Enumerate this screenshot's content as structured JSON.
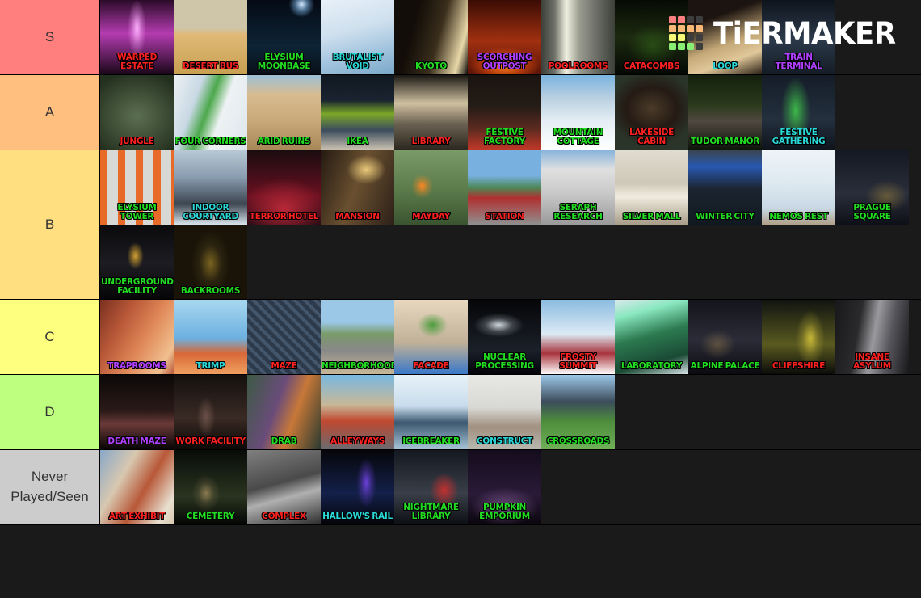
{
  "logo": {
    "text": "TiERMAKER",
    "grid_colors": [
      "#f98080",
      "#f98080",
      "#3d3d3d",
      "#3d3d3d",
      "#f8b878",
      "#f8b878",
      "#f8b878",
      "#f8b878",
      "#f8f878",
      "#f8f878",
      "#3d3d3d",
      "#3d3d3d",
      "#88ef74",
      "#88ef74",
      "#88ef74",
      "#3d3d3d"
    ]
  },
  "background": "#1a1a1a",
  "tiers": [
    {
      "label": "S",
      "color": "#ff7f7f",
      "items": [
        {
          "name": "WARPED ESTATE",
          "text_color": "#ff2020",
          "g1": "#2a0a28",
          "g2": "#b43cb0",
          "g3": "#1a0618",
          "accent": "#ffb0ff",
          "style": "neon-pillar"
        },
        {
          "name": "DESERT BUS",
          "text_color": "#ff2020",
          "g1": "#cfc5a8",
          "g2": "#e0b978",
          "g3": "#c8a050",
          "accent": "#f0e4c0",
          "style": "desert"
        },
        {
          "name": "ELYSIUM MOONBASE",
          "text_color": "#22dd22",
          "g1": "#050a14",
          "g2": "#0d2436",
          "g3": "#081018",
          "accent": "#cfe8ff",
          "style": "moon"
        },
        {
          "name": "BRUTALIST VOID",
          "text_color": "#2ad8d8",
          "g1": "#cfe0ee",
          "g2": "#9fc2dd",
          "g3": "#e8f0f8",
          "accent": "#ffffff",
          "style": "sky"
        },
        {
          "name": "KYOTO",
          "text_color": "#22dd22",
          "g1": "#120d08",
          "g2": "#3a2e1c",
          "g3": "#0a0806",
          "accent": "#e8d8a8",
          "style": "interior-dark"
        },
        {
          "name": "SCORCHING OUTPOST",
          "text_color": "#b040ff",
          "g1": "#3a0c05",
          "g2": "#a03010",
          "g3": "#5a1408",
          "accent": "#ff8820",
          "style": "lava"
        },
        {
          "name": "POOLROOMS",
          "text_color": "#ff2020",
          "g1": "#6e7068",
          "g2": "#9a9c90",
          "g3": "#3c4038",
          "accent": "#f0f0e0",
          "style": "corridor"
        },
        {
          "name": "CATACOMBS",
          "text_color": "#ff2020",
          "g1": "#060a04",
          "g2": "#1c2a10",
          "g3": "#040804",
          "accent": "#68e030",
          "style": "cave"
        },
        {
          "name": "LOOP",
          "text_color": "#2ad8d8",
          "g1": "#1c1410",
          "g2": "#c4a878",
          "g3": "#2a1e14",
          "accent": "#e0c89a",
          "style": "corridor-warm"
        },
        {
          "name": "TRAIN TERMINAL",
          "text_color": "#b040ff",
          "g1": "#0e141c",
          "g2": "#2c3a4a",
          "g3": "#141c26",
          "accent": "#8aa0b8",
          "style": "night-rail"
        }
      ]
    },
    {
      "label": "A",
      "color": "#ffbf7f",
      "items": [
        {
          "name": "JUNGLE",
          "text_color": "#ff2020",
          "g1": "#3a4a34",
          "g2": "#5c6e50",
          "g3": "#24301e",
          "accent": "#8a9c78",
          "style": "foggy-green"
        },
        {
          "name": "FOUR CORNERS",
          "text_color": "#22dd22",
          "g1": "#eef2f4",
          "g2": "#c8d8e4",
          "g3": "#dde6ec",
          "accent": "#4ca84c",
          "style": "bright-hall"
        },
        {
          "name": "ARID RUINS",
          "text_color": "#22dd22",
          "g1": "#c8a878",
          "g2": "#d8bc90",
          "g3": "#a88858",
          "accent": "#6a9050",
          "style": "ruins"
        },
        {
          "name": "IKEA",
          "text_color": "#22dd22",
          "g1": "#1a2430",
          "g2": "#3c4c5c",
          "g3": "#101820",
          "accent": "#7aa828",
          "style": "store"
        },
        {
          "name": "LIBRARY",
          "text_color": "#ff2020",
          "g1": "#1a1814",
          "g2": "#6a6050",
          "g3": "#2c2820",
          "accent": "#cfc0a0",
          "style": "shelves"
        },
        {
          "name": "FESTIVE FACTORY",
          "text_color": "#22dd22",
          "g1": "#1a1410",
          "g2": "#5c2a20",
          "g3": "#241c16",
          "accent": "#c03828",
          "style": "factory"
        },
        {
          "name": "MOUNTAIN COTTAGE",
          "text_color": "#22dd22",
          "g1": "#b8cfe0",
          "g2": "#e4eef4",
          "g3": "#9ab8cf",
          "accent": "#ffffff",
          "style": "snow-day"
        },
        {
          "name": "LAKESIDE CABIN",
          "text_color": "#ff2020",
          "g1": "#241a14",
          "g2": "#4a3a28",
          "g3": "#2a3428",
          "accent": "#6a4a30",
          "style": "cabin"
        },
        {
          "name": "TUDOR MANOR",
          "text_color": "#22dd22",
          "g1": "#14200e",
          "g2": "#2a3a1c",
          "g3": "#0c140a",
          "accent": "#504840",
          "style": "manor"
        },
        {
          "name": "FESTIVE GATHERING",
          "text_color": "#2ad8d8",
          "g1": "#141c28",
          "g2": "#24303e",
          "g3": "#0e141c",
          "accent": "#3cb848",
          "style": "xmas-tree"
        }
      ]
    },
    {
      "label": "B",
      "color": "#ffdf80",
      "items": [
        {
          "name": "ELYSIUM TOWER",
          "text_color": "#22dd22",
          "g1": "#d8d8d4",
          "g2": "#e86a28",
          "g3": "#b8b8b4",
          "accent": "#f07838",
          "style": "orange-tower"
        },
        {
          "name": "INDOOR COURTYARD",
          "text_color": "#2ad8d8",
          "g1": "#8a9cb0",
          "g2": "#b8c8d4",
          "g3": "#3c4650",
          "accent": "#d8e4ec",
          "style": "courtyard"
        },
        {
          "name": "TERROR HOTEL",
          "text_color": "#ff2020",
          "g1": "#1a0c10",
          "g2": "#6a1020",
          "g3": "#2a0c14",
          "accent": "#b82838",
          "style": "hotel-red"
        },
        {
          "name": "MANSION",
          "text_color": "#ff2020",
          "g1": "#241a12",
          "g2": "#6a5030",
          "g3": "#2c2018",
          "accent": "#e8c878",
          "style": "mansion-hall"
        },
        {
          "name": "MAYDAY",
          "text_color": "#ff2020",
          "g1": "#5a7a4a",
          "g2": "#7a9a68",
          "g3": "#3a5430",
          "accent": "#ff8820",
          "style": "crash"
        },
        {
          "name": "STATION",
          "text_color": "#ff2020",
          "g1": "#78b0e0",
          "g2": "#4c8858",
          "g3": "#909090",
          "accent": "#b03030",
          "style": "town"
        },
        {
          "name": "SERAPH RESEARCH",
          "text_color": "#22dd22",
          "g1": "#88b4dc",
          "g2": "#c8c8c8",
          "g3": "#9a9a9a",
          "accent": "#e0e0e0",
          "style": "city-block"
        },
        {
          "name": "SILVER MALL",
          "text_color": "#22dd22",
          "g1": "#cfc8b8",
          "g2": "#e0dcd0",
          "g3": "#a89c88",
          "accent": "#f0ece0",
          "style": "mall"
        },
        {
          "name": "WINTER CITY",
          "text_color": "#22dd22",
          "g1": "#1c2430",
          "g2": "#3a4450",
          "g3": "#101820",
          "accent": "#2858b0",
          "style": "winter-city"
        },
        {
          "name": "NEMOS REST",
          "text_color": "#22dd22",
          "g1": "#eef4f8",
          "g2": "#dce8f0",
          "g3": "#c8d8e4",
          "accent": "#b0a088",
          "style": "snowport"
        },
        {
          "name": "PRAGUE SQUARE",
          "text_color": "#22dd22",
          "g1": "#141822",
          "g2": "#2a2e3a",
          "g3": "#0e1018",
          "accent": "#d8b040",
          "style": "square-night"
        },
        {
          "name": "UNDERGROUND FACILITY",
          "text_color": "#22dd22",
          "g1": "#0a0a0c",
          "g2": "#1c1c22",
          "g3": "#060608",
          "accent": "#d0a030",
          "style": "underground"
        },
        {
          "name": "BACKROOMS",
          "text_color": "#22dd22",
          "g1": "#2c2410",
          "g2": "#7a6420",
          "g3": "#1a1408",
          "accent": "#c8a838",
          "style": "backrooms"
        }
      ]
    },
    {
      "label": "C",
      "color": "#ffff7f",
      "items": [
        {
          "name": "TRAPROOMS",
          "text_color": "#b040ff",
          "g1": "#b85838",
          "g2": "#e08858",
          "g3": "#7a3020",
          "accent": "#f0c090",
          "style": "traprooms"
        },
        {
          "name": "TRIMP",
          "text_color": "#2ad8d8",
          "g1": "#6cb0e0",
          "g2": "#a8d8f0",
          "g3": "#d86838",
          "accent": "#f0a060",
          "style": "trimp"
        },
        {
          "name": "MAZE",
          "text_color": "#ff2020",
          "g1": "#2c3a4c",
          "g2": "#44566c",
          "g3": "#1c2630",
          "accent": "#6a7f94",
          "style": "maze"
        },
        {
          "name": "NEIGHBORHOOD",
          "text_color": "#22dd22",
          "g1": "#9cc8e8",
          "g2": "#7a9a6a",
          "g3": "#888888",
          "accent": "#c8b898",
          "style": "neighborhood"
        },
        {
          "name": "FACADE",
          "text_color": "#ff2020",
          "g1": "#e8d8c0",
          "g2": "#4c9c3c",
          "g3": "#c0b098",
          "accent": "#3878c8",
          "style": "facade"
        },
        {
          "name": "NUCLEAR PROCESSING",
          "text_color": "#22dd22",
          "g1": "#060608",
          "g2": "#1a2028",
          "g3": "#04040a",
          "accent": "#d0d8e0",
          "style": "nuclear"
        },
        {
          "name": "FROSTY SUMMIT",
          "text_color": "#ff2020",
          "g1": "#8cbce0",
          "g2": "#dceaf4",
          "g3": "#a8343c",
          "accent": "#ffffff",
          "style": "frosty"
        },
        {
          "name": "LABORATORY",
          "text_color": "#22dd22",
          "g1": "#1a4a34",
          "g2": "#2c7a50",
          "g3": "#dce8ec",
          "accent": "#8ae8c0",
          "style": "lab"
        },
        {
          "name": "ALPINE PALACE",
          "text_color": "#22dd22",
          "g1": "#14141c",
          "g2": "#2c2c38",
          "g3": "#0a0a10",
          "accent": "#d8b060",
          "style": "alpine"
        },
        {
          "name": "CLIFFSHIRE",
          "text_color": "#ff2020",
          "g1": "#101410",
          "g2": "#5a5a20",
          "g3": "#0a0c0a",
          "accent": "#c8b838",
          "style": "cliffshire"
        },
        {
          "name": "INSANE ASYLUM",
          "text_color": "#ff2020",
          "g1": "#2a2a2c",
          "g2": "#54545a",
          "g3": "#18181a",
          "accent": "#9a9a9e",
          "style": "asylum"
        }
      ]
    },
    {
      "label": "D",
      "color": "#bfff7f",
      "items": [
        {
          "name": "DEATH MAZE",
          "text_color": "#b040ff",
          "g1": "#0c0808",
          "g2": "#2a1a18",
          "g3": "#060404",
          "accent": "#6a3a38",
          "style": "death-maze"
        },
        {
          "name": "WORK FACILITY",
          "text_color": "#ff2020",
          "g1": "#14100e",
          "g2": "#3a2a24",
          "g3": "#0a0806",
          "accent": "#6a5048",
          "style": "work-facility"
        },
        {
          "name": "DRAB",
          "text_color": "#22dd22",
          "g1": "#3c5a44",
          "g2": "#6a4c7a",
          "g3": "#2a3a30",
          "accent": "#c87838",
          "style": "drab"
        },
        {
          "name": "ALLEYWAYS",
          "text_color": "#ff2020",
          "g1": "#78b8e0",
          "g2": "#c8b898",
          "g3": "#6a6a70",
          "accent": "#c04830",
          "style": "alleyways"
        },
        {
          "name": "ICEBREAKER",
          "text_color": "#22dd22",
          "g1": "#c8dcec",
          "g2": "#e8f2f8",
          "g3": "#a8c4d8",
          "accent": "#3c5870",
          "style": "icebreaker"
        },
        {
          "name": "CONSTRUCT",
          "text_color": "#2ad8d8",
          "g1": "#d8d8d4",
          "g2": "#e8e8e4",
          "g3": "#b8b8b0",
          "accent": "#a09080",
          "style": "construct"
        },
        {
          "name": "CROSSROADS",
          "text_color": "#22dd22",
          "g1": "#9cc8e8",
          "g2": "#4c8c3c",
          "g3": "#3c4c5c",
          "accent": "#70b058",
          "style": "crossroads"
        }
      ]
    },
    {
      "label": "Never Played/Seen",
      "color": "#cccccc",
      "items": [
        {
          "name": "ART EXHIBIT",
          "text_color": "#ff2020",
          "g1": "#d8c8b0",
          "g2": "#b85838",
          "g3": "#88a8c8",
          "accent": "#e8e0d0",
          "style": "art-exhibit"
        },
        {
          "name": "CEMETERY",
          "text_color": "#22dd22",
          "g1": "#080c08",
          "g2": "#2a3420",
          "g3": "#040604",
          "accent": "#8a7a50",
          "style": "cemetery"
        },
        {
          "name": "COMPLEX",
          "text_color": "#ff2020",
          "g1": "#4a4a4a",
          "g2": "#808080",
          "g3": "#2c2c2c",
          "accent": "#b0b0b0",
          "style": "complex"
        },
        {
          "name": "HALLOW'S RAIL",
          "text_color": "#2ad8d8",
          "g1": "#06060a",
          "g2": "#14204a",
          "g3": "#040408",
          "accent": "#6a40d8",
          "style": "hallows-rail"
        },
        {
          "name": "NIGHTMARE LIBRARY",
          "text_color": "#22dd22",
          "g1": "#141820",
          "g2": "#3a3e48",
          "g3": "#0c1014",
          "accent": "#c03030",
          "style": "nightmare-library"
        },
        {
          "name": "PUMPKIN EMPORIUM",
          "text_color": "#22dd22",
          "g1": "#140c1c",
          "g2": "#2a1a38",
          "g3": "#0a060e",
          "accent": "#6a4a7a",
          "style": "pumpkin"
        }
      ]
    }
  ]
}
